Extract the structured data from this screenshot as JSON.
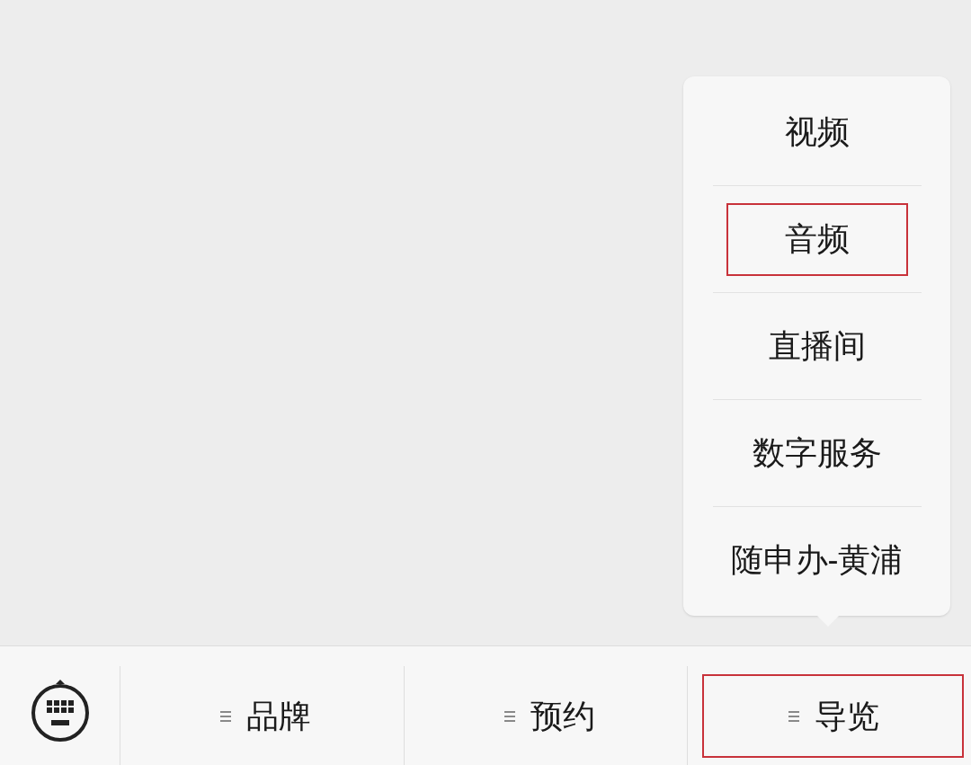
{
  "popup_menu": {
    "items": [
      {
        "label": "视频",
        "highlighted": false
      },
      {
        "label": "音频",
        "highlighted": true
      },
      {
        "label": "直播间",
        "highlighted": false
      },
      {
        "label": "数字服务",
        "highlighted": false
      },
      {
        "label": "随申办-黄浦",
        "highlighted": false
      }
    ]
  },
  "bottom_bar": {
    "tabs": [
      {
        "label": "品牌",
        "highlighted": false
      },
      {
        "label": "预约",
        "highlighted": false
      },
      {
        "label": "导览",
        "highlighted": true
      }
    ]
  }
}
